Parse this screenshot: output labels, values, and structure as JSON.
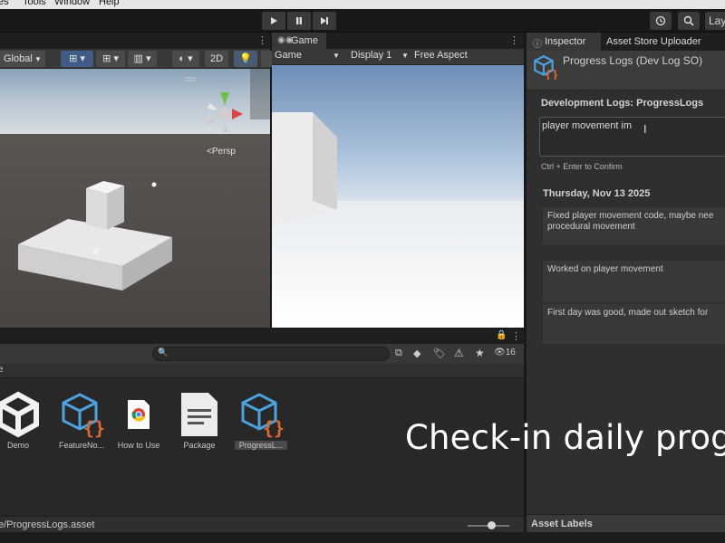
{
  "menu": {
    "items": [
      "es",
      "Tools",
      "Window",
      "Help"
    ]
  },
  "toolbar": {
    "play_icon": "play-icon",
    "pause_icon": "pause-icon",
    "step_icon": "step-icon",
    "layout_label": "Lay"
  },
  "scene": {
    "global_label": "Global",
    "mode_2d_label": "2D",
    "persp_label": "Persp"
  },
  "game": {
    "tab_label": "Game",
    "mode_label": "Game",
    "display_label": "Display 1",
    "aspect_label": "Free Aspect"
  },
  "project": {
    "hidden_count": "16",
    "path": "e/ProgressLogs.asset",
    "breadcrumb_fragment": "e",
    "assets": [
      {
        "label": "Demo",
        "icon": "unity-logo-icon"
      },
      {
        "label": "FeatureNo...",
        "icon": "scriptable-object-icon"
      },
      {
        "label": "How to Use",
        "icon": "chrome-document-icon"
      },
      {
        "label": "Package",
        "icon": "text-document-icon"
      },
      {
        "label": "ProgressL...",
        "icon": "scriptable-object-icon"
      }
    ]
  },
  "inspector": {
    "tab_inspector": "Inspector",
    "tab_asset_store": "Asset Store Uploader",
    "object_title": "Progress Logs (Dev Log SO)",
    "section_title": "Development Logs: ProgressLogs",
    "input_value": "player movement im",
    "hint": "Ctrl + Enter to Confirm",
    "date_header": "Thursday, Nov 13 2025",
    "entries": [
      {
        "line1": "Fixed player movement code, maybe nee",
        "line2": "procedural movement"
      },
      {
        "line1": "Worked on player movement",
        "line2": ""
      },
      {
        "line1": "First day was good, made out sketch for",
        "line2": ""
      }
    ],
    "asset_labels": "Asset Labels"
  },
  "caption": "Check-in daily progr"
}
